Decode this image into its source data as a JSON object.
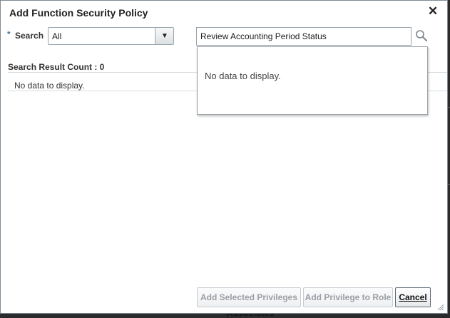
{
  "dialog": {
    "title": "Add Function Security Policy",
    "close_glyph": "✕"
  },
  "search": {
    "required_marker": "*",
    "label": "Search",
    "scope_value": "All",
    "scope_icon": "caret-down-icon",
    "query_value": "Review Accounting Period Status",
    "search_icon": "magnifier-icon"
  },
  "suggestions": {
    "empty_text": "No data to display."
  },
  "results": {
    "count_label": "Search Result Count : 0",
    "empty_text": "No data to display."
  },
  "footer": {
    "add_selected_label": "Add Selected Privileges",
    "add_to_role_label": "Add Privilege to Role",
    "cancel_label": "Cancel"
  },
  "background": {
    "partial_text": "Associates"
  },
  "colors": {
    "required": "#4b7ba8",
    "disabled_text": "#9a9fa4",
    "overlay": "#2b2b2b"
  }
}
